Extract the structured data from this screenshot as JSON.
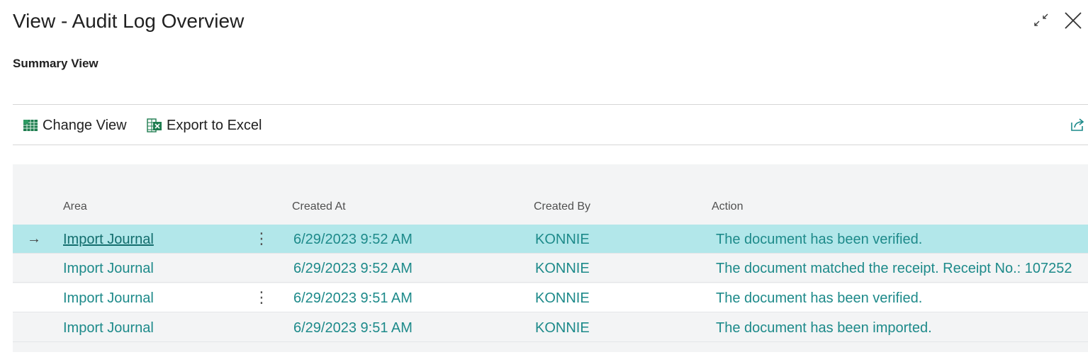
{
  "window": {
    "title": "View - Audit Log Overview",
    "controls": [
      {
        "icon": "collapse-icon"
      },
      {
        "icon": "close-icon"
      }
    ]
  },
  "subtitle": "Summary View",
  "action_bar": {
    "change_view_label": "Change View",
    "change_view_icon": "change-view-icon",
    "export_label": "Export to Excel",
    "export_icon": "excel-icon",
    "share_icon": "share-icon"
  },
  "grid": {
    "columns": {
      "area": "Area",
      "created_at": "Created At",
      "created_by": "Created By",
      "action": "Action"
    },
    "rows": [
      {
        "area": "Import Journal",
        "created_at": "6/29/2023 9:52 AM",
        "created_by": "KONNIE",
        "action": "The document has been verified.",
        "selected": true,
        "has_menu": true
      },
      {
        "area": "Import Journal",
        "created_at": "6/29/2023 9:52 AM",
        "created_by": "KONNIE",
        "action": "The document matched the receipt. Receipt No.: 107252",
        "selected": false,
        "has_menu": false
      },
      {
        "area": "Import Journal",
        "created_at": "6/29/2023 9:51 AM",
        "created_by": "KONNIE",
        "action": "The document has been verified.",
        "selected": false,
        "has_menu": true
      },
      {
        "area": "Import Journal",
        "created_at": "6/29/2023 9:51 AM",
        "created_by": "KONNIE",
        "action": "The document has been imported.",
        "selected": false,
        "has_menu": false
      }
    ]
  },
  "colors": {
    "accent": "#1d8a8a",
    "selected_row": "#b2e7ea",
    "grid_background": "#f3f4f5"
  }
}
